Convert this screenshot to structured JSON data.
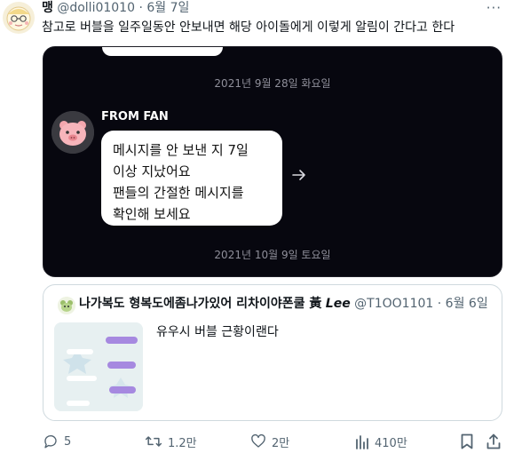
{
  "tweet": {
    "display_name": "맹",
    "handle": "@dolli01010",
    "separator": "·",
    "date": "6월 7일",
    "more_label": "···",
    "text": "참고로 버블을 일주일동안 안보내면 해당 아이돌에게 이렇게 알림이 간다고 한다"
  },
  "media": {
    "date_top": "2021년 9월 28일 화요일",
    "sender": "FROM FAN",
    "message_lines": [
      "메시지를 안 보낸 지 7일",
      "이상 지났어요",
      "팬들의 간절한 메시지를",
      "확인해 보세요"
    ],
    "date_bottom": "2021년 10월 9일 토요일"
  },
  "quote": {
    "display_name": "나가복도 형복도에좀나가있어 리차이야폰쿨 黃",
    "display_name_en": "Lee",
    "handle": "@T1OO1101",
    "separator": "·",
    "date": "6월 6일",
    "text": "유우시 버블 근황이랜다"
  },
  "actions": {
    "reply_count": "5",
    "retweet_count": "1.2만",
    "like_count": "2만",
    "view_count": "410만"
  },
  "colors": {
    "text_primary": "#0f1419",
    "text_secondary": "#536471",
    "media_background": "#07070f",
    "border": "#cfd9de"
  }
}
